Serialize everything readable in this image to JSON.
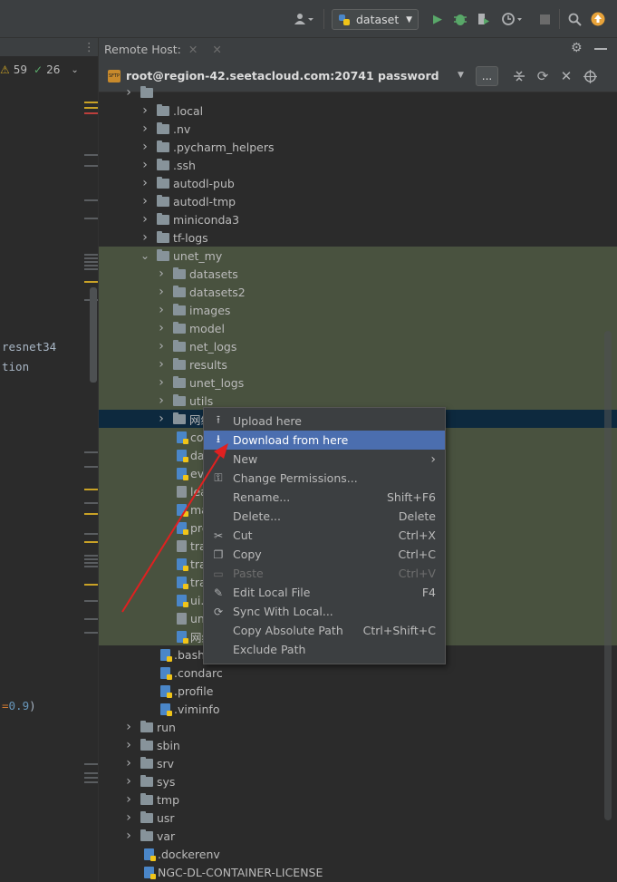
{
  "toolbar": {
    "config_name": "dataset",
    "user_icon": "user-icon",
    "run_icon": "run-icon",
    "debug_icon": "debug-icon",
    "coverage_icon": "coverage-icon",
    "profile_icon": "profile-icon",
    "stop_icon": "stop-icon",
    "search_icon": "search-icon",
    "update_icon": "update-icon"
  },
  "left_panel": {
    "warnings": "59",
    "weak_warnings": "26",
    "code_lines": [
      "resnet34",
      "tion",
      "=0.9)"
    ]
  },
  "remote": {
    "tab_label": "Remote Host:",
    "server": "root@region-42.seetacloud.com:20741 password",
    "more_button": "..."
  },
  "tree": [
    {
      "label": "",
      "type": "folder",
      "depth": 0,
      "partial": true
    },
    {
      "label": ".local",
      "type": "folder",
      "depth": 1,
      "expanded": false
    },
    {
      "label": ".nv",
      "type": "folder",
      "depth": 1,
      "expanded": false
    },
    {
      "label": ".pycharm_helpers",
      "type": "folder",
      "depth": 1,
      "expanded": false
    },
    {
      "label": ".ssh",
      "type": "folder",
      "depth": 1,
      "expanded": false
    },
    {
      "label": "autodl-pub",
      "type": "folder",
      "depth": 1,
      "expanded": false
    },
    {
      "label": "autodl-tmp",
      "type": "folder",
      "depth": 1,
      "expanded": false
    },
    {
      "label": "miniconda3",
      "type": "folder",
      "depth": 1,
      "expanded": false
    },
    {
      "label": "tf-logs",
      "type": "folder",
      "depth": 1,
      "expanded": false
    },
    {
      "label": "unet_my",
      "type": "folder",
      "depth": 1,
      "expanded": true,
      "hl": true
    },
    {
      "label": "datasets",
      "type": "folder",
      "depth": 2,
      "expanded": false,
      "hl": true
    },
    {
      "label": "datasets2",
      "type": "folder",
      "depth": 2,
      "expanded": false,
      "hl": true
    },
    {
      "label": "images",
      "type": "folder",
      "depth": 2,
      "expanded": false,
      "hl": true
    },
    {
      "label": "model",
      "type": "folder",
      "depth": 2,
      "expanded": false,
      "hl": true
    },
    {
      "label": "net_logs",
      "type": "folder",
      "depth": 2,
      "expanded": false,
      "hl": true
    },
    {
      "label": "results",
      "type": "folder",
      "depth": 2,
      "expanded": false,
      "hl": true
    },
    {
      "label": "unet_logs",
      "type": "folder",
      "depth": 2,
      "expanded": false,
      "hl": true
    },
    {
      "label": "utils",
      "type": "folder",
      "depth": 2,
      "expanded": false,
      "hl": true
    },
    {
      "label": "网络",
      "type": "folder",
      "depth": 2,
      "expanded": false,
      "sel": true
    },
    {
      "label": "con",
      "type": "py",
      "depth": 2,
      "hl": true
    },
    {
      "label": "dat",
      "type": "py",
      "depth": 2,
      "hl": true
    },
    {
      "label": "eva",
      "type": "py",
      "depth": 2,
      "hl": true
    },
    {
      "label": "lea",
      "type": "txt",
      "depth": 2,
      "hl": true
    },
    {
      "label": "ma",
      "type": "py",
      "depth": 2,
      "hl": true
    },
    {
      "label": "pre",
      "type": "py",
      "depth": 2,
      "hl": true
    },
    {
      "label": "tra",
      "type": "txt",
      "depth": 2,
      "hl": true
    },
    {
      "label": "tra",
      "type": "py",
      "depth": 2,
      "hl": true
    },
    {
      "label": "tra",
      "type": "py",
      "depth": 2,
      "hl": true
    },
    {
      "label": "ui.p",
      "type": "py",
      "depth": 2,
      "hl": true
    },
    {
      "label": "une",
      "type": "txt",
      "depth": 2,
      "hl": true
    },
    {
      "label": "网络",
      "type": "py",
      "depth": 2,
      "hl": true
    },
    {
      "label": ".bashr",
      "type": "py",
      "depth": 1
    },
    {
      "label": ".condarc",
      "type": "py",
      "depth": 1
    },
    {
      "label": ".profile",
      "type": "py",
      "depth": 1
    },
    {
      "label": ".viminfo",
      "type": "py",
      "depth": 1
    },
    {
      "label": "run",
      "type": "folder",
      "depth": 0,
      "expanded": false
    },
    {
      "label": "sbin",
      "type": "folder",
      "depth": 0,
      "expanded": false
    },
    {
      "label": "srv",
      "type": "folder",
      "depth": 0,
      "expanded": false
    },
    {
      "label": "sys",
      "type": "folder",
      "depth": 0,
      "expanded": false
    },
    {
      "label": "tmp",
      "type": "folder",
      "depth": 0,
      "expanded": false
    },
    {
      "label": "usr",
      "type": "folder",
      "depth": 0,
      "expanded": false
    },
    {
      "label": "var",
      "type": "folder",
      "depth": 0,
      "expanded": false
    },
    {
      "label": ".dockerenv",
      "type": "py",
      "depth": 0
    },
    {
      "label": "NGC-DL-CONTAINER-LICENSE",
      "type": "py",
      "depth": 0
    }
  ],
  "context_menu": [
    {
      "label": "Upload here",
      "icon": "upload-icon",
      "glyph": "⭱",
      "shortcut": ""
    },
    {
      "label": "Download from here",
      "icon": "download-icon",
      "glyph": "⭳",
      "shortcut": "",
      "active": true
    },
    {
      "label": "New",
      "icon": "",
      "glyph": "",
      "shortcut": "",
      "submenu": true
    },
    {
      "label": "Change Permissions...",
      "icon": "key-icon",
      "glyph": "⚿",
      "shortcut": ""
    },
    {
      "label": "Rename...",
      "icon": "",
      "glyph": "",
      "shortcut": "Shift+F6"
    },
    {
      "label": "Delete...",
      "icon": "",
      "glyph": "",
      "shortcut": "Delete"
    },
    {
      "label": "Cut",
      "icon": "scissors-icon",
      "glyph": "✂",
      "shortcut": "Ctrl+X"
    },
    {
      "label": "Copy",
      "icon": "copy-icon",
      "glyph": "❐",
      "shortcut": "Ctrl+C"
    },
    {
      "label": "Paste",
      "icon": "paste-icon",
      "glyph": "▭",
      "shortcut": "Ctrl+V",
      "disabled": true
    },
    {
      "label": "Edit Local File",
      "icon": "pencil-icon",
      "glyph": "✎",
      "shortcut": "F4"
    },
    {
      "label": "Sync With Local...",
      "icon": "sync-icon",
      "glyph": "⟳",
      "shortcut": ""
    },
    {
      "label": "Copy Absolute Path",
      "icon": "",
      "glyph": "",
      "shortcut": "Ctrl+Shift+C"
    },
    {
      "label": "Exclude Path",
      "icon": "",
      "glyph": "",
      "shortcut": ""
    }
  ],
  "colors": {
    "annotation_arrow": "#e02020",
    "menu_active": "#4b6eaf",
    "highlight_row": "#49523f",
    "selected_row": "#0d293e"
  }
}
